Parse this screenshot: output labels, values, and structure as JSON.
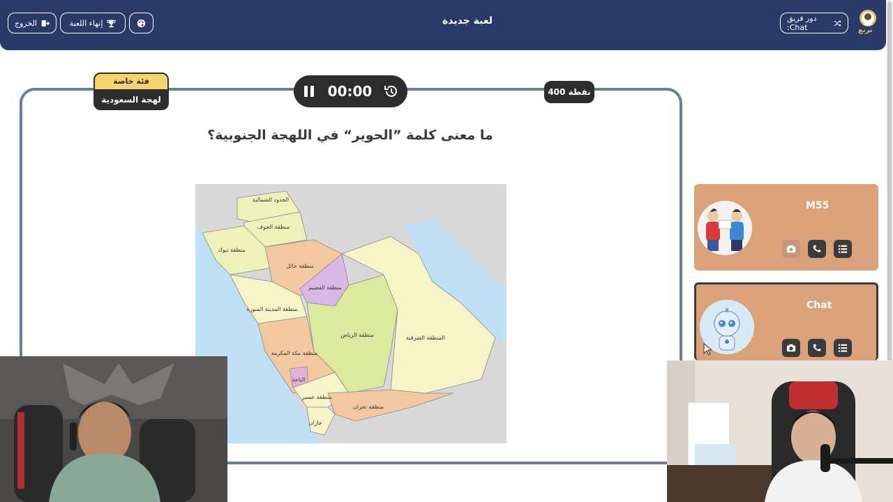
{
  "header": {
    "title": "لعبة جديدة",
    "exit_label": "الخروج",
    "end_game_label": "إنهاء اللعبة",
    "team_turn_label": "دور فريق :Chat",
    "logo_text": "تربع"
  },
  "question_card": {
    "category_top": "فئة خاصة",
    "category_name": "لهجة السعودية",
    "timer": "00:00",
    "points": "400 نقطة",
    "question": "ما معنى كلمة ”الحوير“ في اللهجة الجنوبية؟"
  },
  "map_labels": {
    "north_border": "الحدود الشمالية",
    "jouf": "منطقة الجوف",
    "tabuk": "منطقة تبوك",
    "hail": "منطقة حائل",
    "qassim": "منطقة القصيم",
    "madinah": "منطقة المدينة المنورة",
    "riyadh": "منطقة الرياض",
    "eastern": "المنطقة الشرقية",
    "makkah": "منطقة مكة المكرمة",
    "baha": "الباحة",
    "asir": "منطقة عسير",
    "najran": "منطقة نجران",
    "jazan": "جازان"
  },
  "teams": [
    {
      "name": "M55"
    },
    {
      "name": "Chat"
    }
  ],
  "colors": {
    "header_bg": "#2a3a68",
    "card_border": "#6b7d9c",
    "panel_bg": "#d9a27a",
    "category_yellow": "#f5d36f",
    "dark": "#2d2d2d"
  }
}
